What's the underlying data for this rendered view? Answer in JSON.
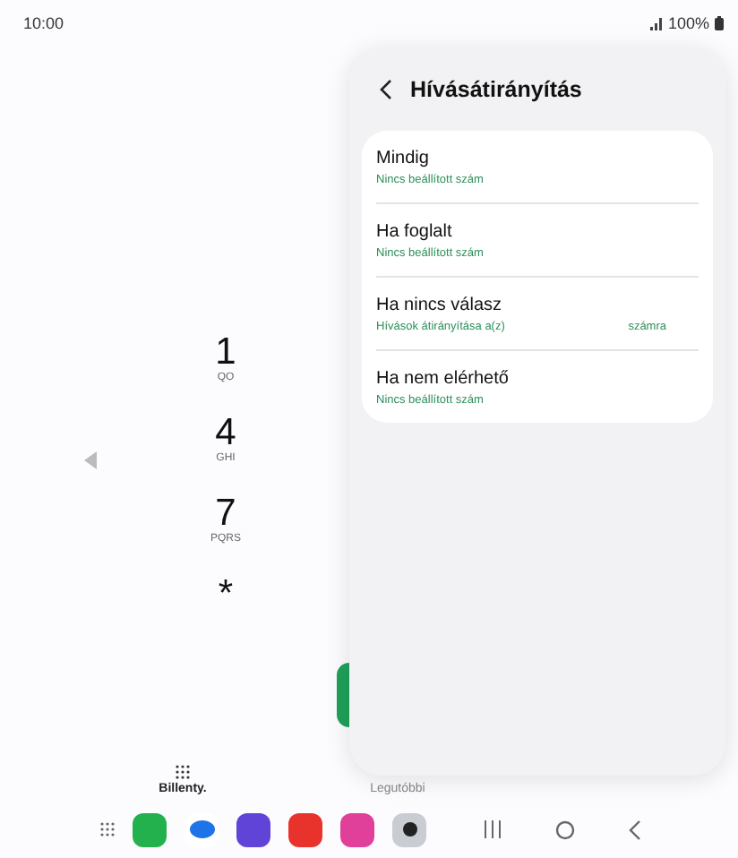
{
  "status_bar": {
    "time": "10:00",
    "battery": "100%"
  },
  "dialer": {
    "keys": [
      {
        "digit": "1",
        "letters": "QO"
      },
      {
        "digit": "4",
        "letters": "GHI"
      },
      {
        "digit": "7",
        "letters": "PQRS"
      },
      {
        "digit": "*"
      }
    ]
  },
  "bottom_tabs": [
    {
      "label": "Billenty.",
      "selected": true
    },
    {
      "label": "Legutóbbi",
      "selected": false
    }
  ],
  "panel": {
    "title": "Hívásátirányítás",
    "items": [
      {
        "title": "Mindig",
        "subtitle": [
          "Nincs beállított szám"
        ]
      },
      {
        "title": "Ha foglalt",
        "subtitle": [
          "Nincs beállított szám"
        ]
      },
      {
        "title": "Ha nincs válasz",
        "subtitle": [
          "Hívások átirányítása a(z)",
          "számra"
        ]
      },
      {
        "title": "Ha nem elérhető",
        "subtitle": [
          "Nincs beállított szám"
        ]
      }
    ]
  }
}
